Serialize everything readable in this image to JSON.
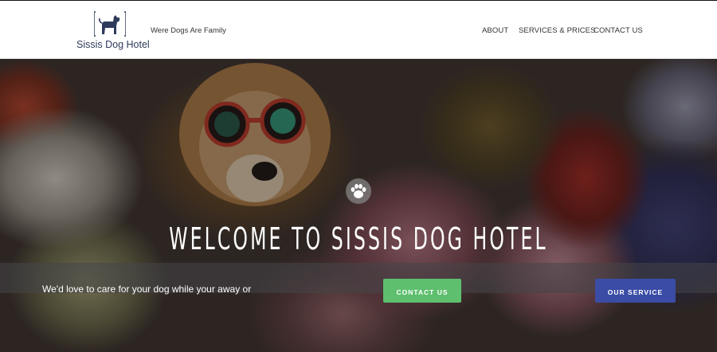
{
  "header": {
    "logo_text": "Sissis Dog Hotel",
    "tagline": "Were Dogs Are Family",
    "nav": [
      {
        "label": "ABOUT"
      },
      {
        "label": "SERVICES & PRICES"
      },
      {
        "label": "CONTACT US"
      }
    ],
    "brand_color": "#2e3b5b"
  },
  "hero": {
    "title": "WELCOME TO SISSIS DOG HOTEL",
    "intro": "We'd love to care for your dog while your away or",
    "buttons": {
      "contact": "CONTACT US",
      "service": "OUR SERVICE"
    },
    "contact_color": "#5ebf6e",
    "service_color": "#3b4ca6",
    "icon": "paw-icon"
  }
}
